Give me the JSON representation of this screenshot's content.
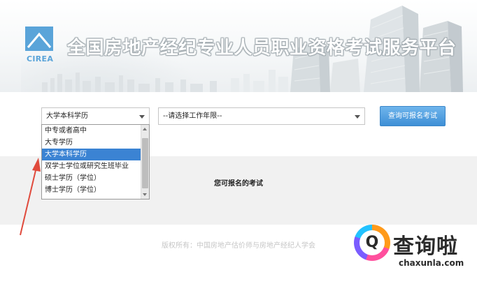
{
  "header": {
    "logo_text": "CIREA",
    "title": "全国房地产经纪专业人员职业资格考试服务平台"
  },
  "form": {
    "education_select": {
      "selected": "大学本科学历",
      "options": [
        "中专或者高中",
        "大专学历",
        "大学本科学历",
        "双学士学位或研究生班毕业",
        "硕士学历（学位）",
        "博士学历（学位）"
      ],
      "selected_index": 2
    },
    "work_years_select": {
      "selected": "--请选择工作年限--"
    },
    "query_button": "查询可报名考试"
  },
  "results": {
    "heading": "您可报名的考试"
  },
  "footer": {
    "copyright": "版权所有：中国房地产估价师与房地产经纪人学会"
  },
  "watermark": {
    "name": "查询啦",
    "url": "chaxunla.com"
  },
  "colors": {
    "accent": "#3e8fd6",
    "selected_option": "#3b83d3",
    "logo": "#5aa4d9",
    "annotation_arrow": "#e04a3c"
  },
  "icons": {
    "logo": "cirea-logo-icon",
    "dropdown": "chevron-down-icon",
    "annotation": "red-arrow-icon"
  }
}
